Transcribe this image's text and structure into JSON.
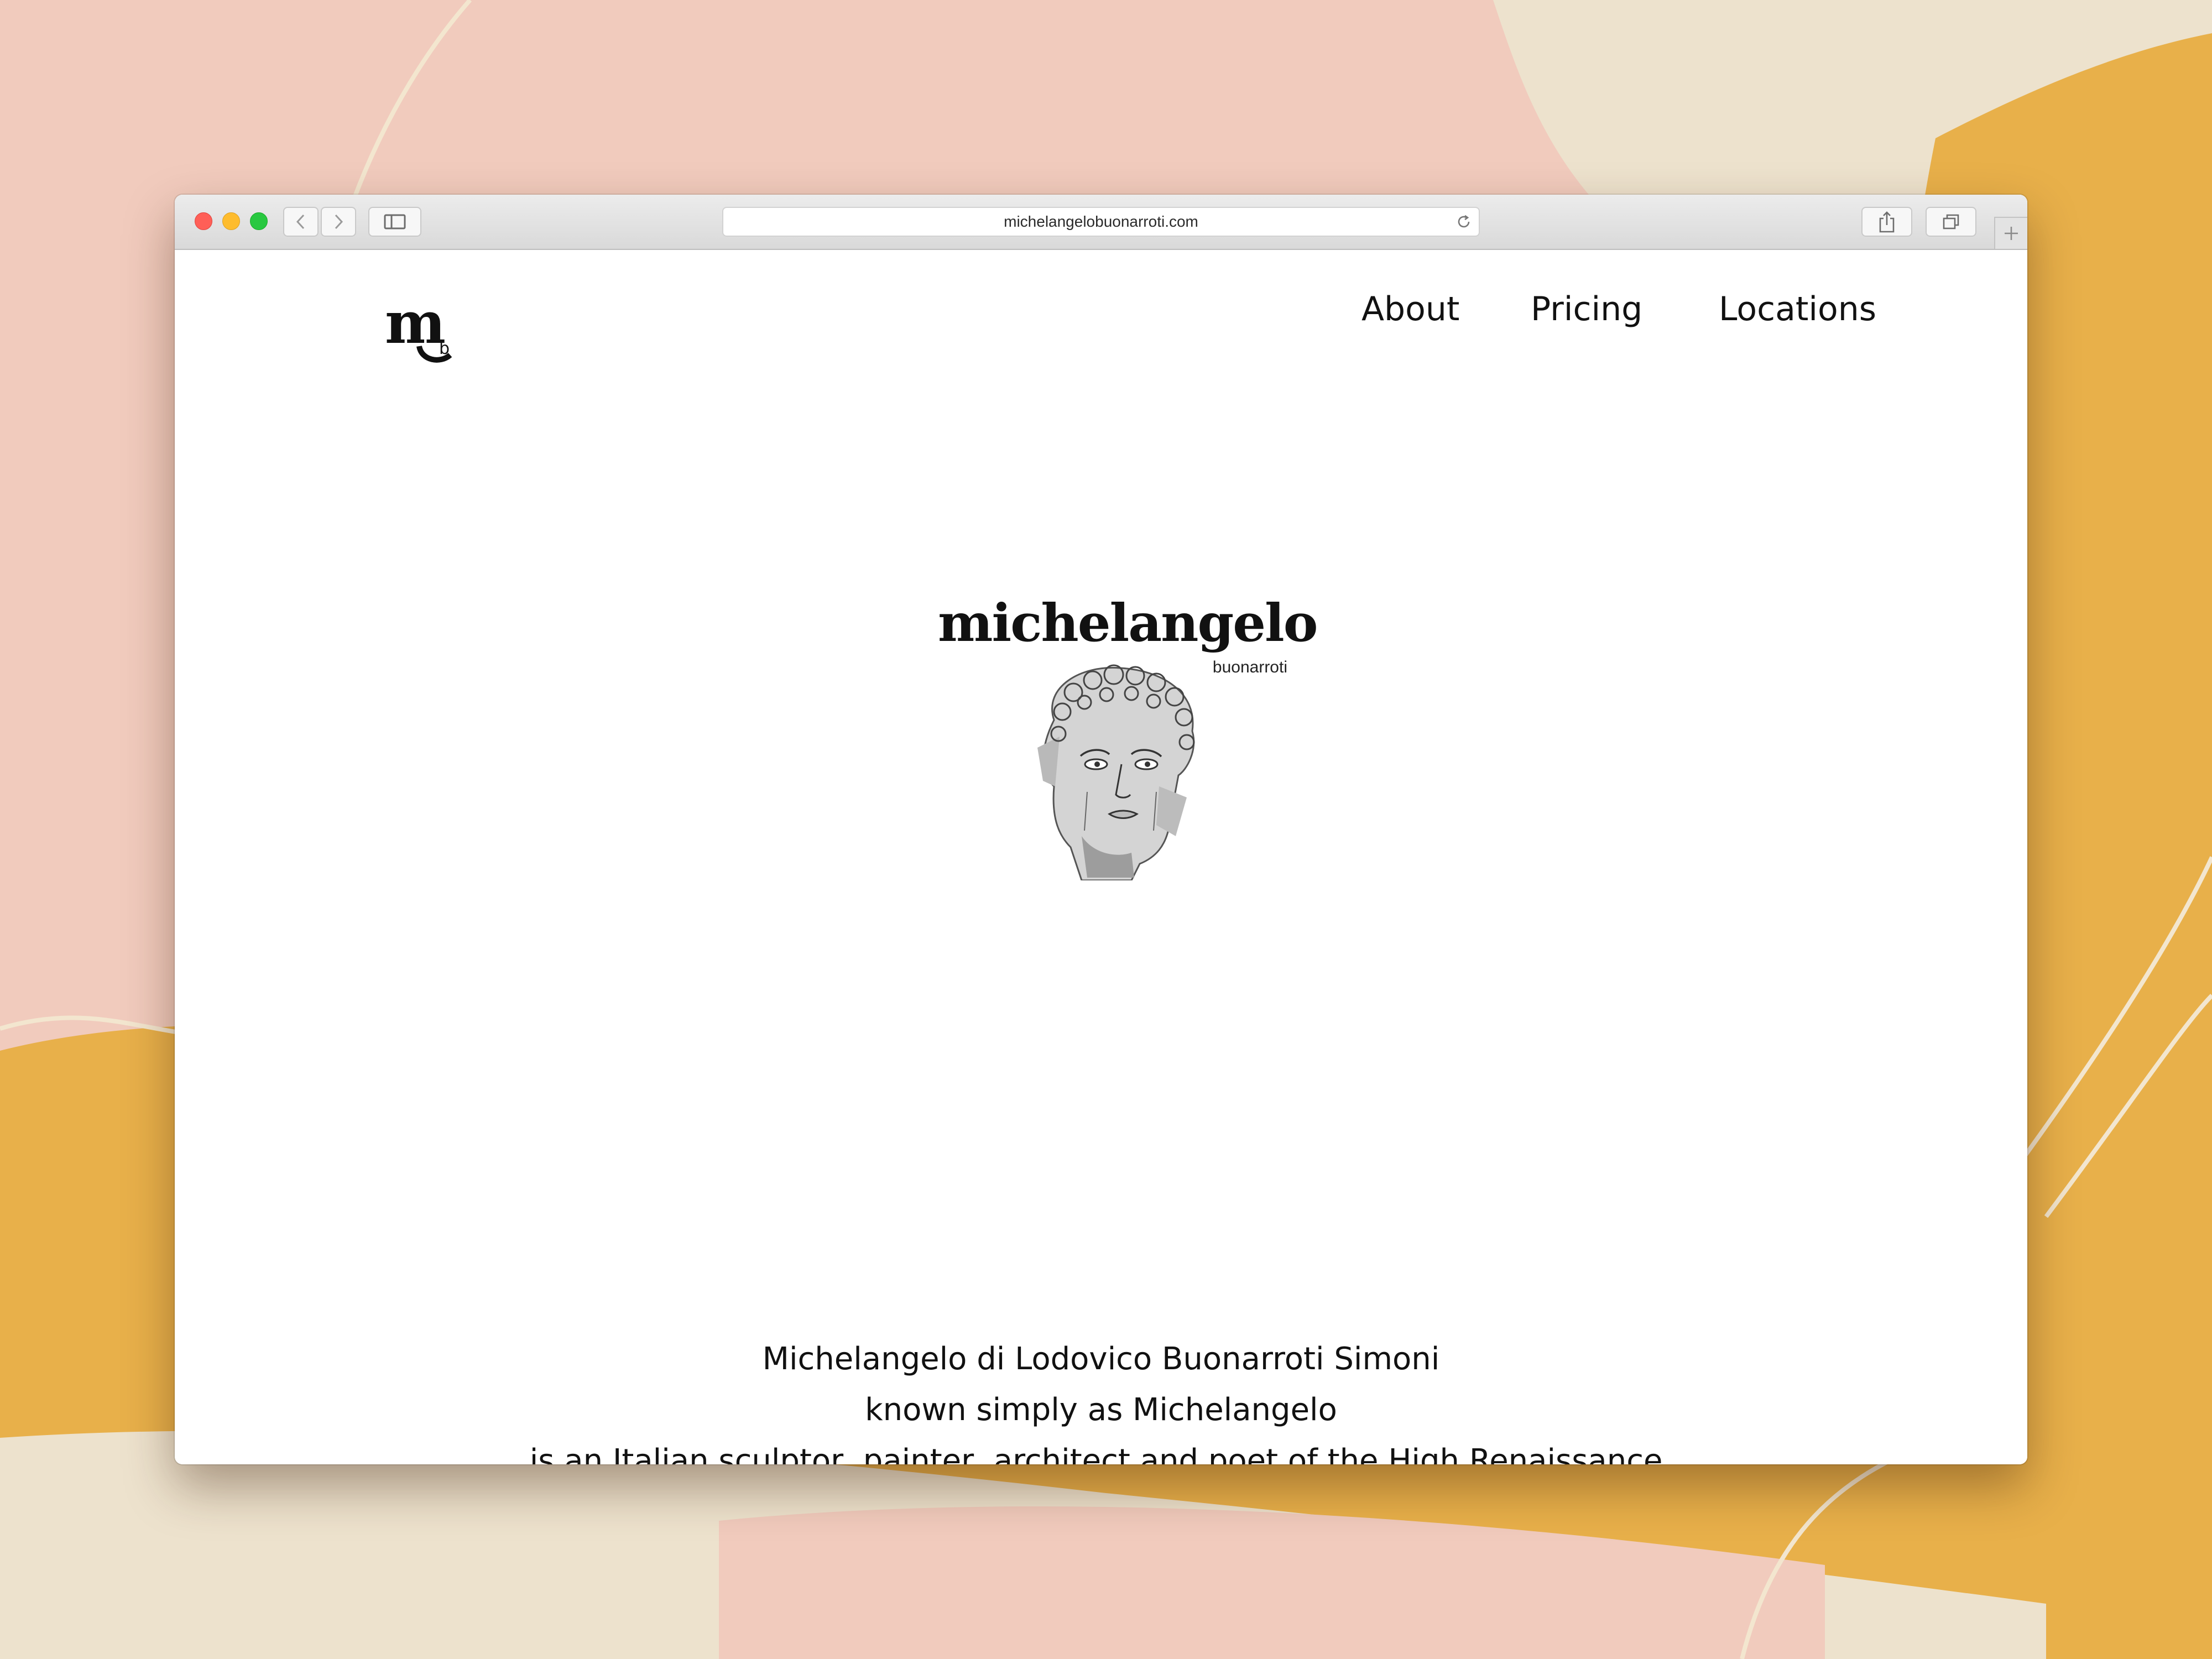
{
  "browser": {
    "url": "michelangelobuonarroti.com",
    "colors": {
      "close": "#ff5f57",
      "minimize": "#febc2e",
      "zoom": "#28c840"
    },
    "icons": [
      "back-icon",
      "forward-icon",
      "sidebar-icon",
      "reload-icon",
      "share-icon",
      "tabs-icon",
      "plus-icon"
    ]
  },
  "site": {
    "logo": {
      "letter": "m",
      "sub": "b"
    },
    "nav": [
      {
        "label": "About"
      },
      {
        "label": "Pricing"
      },
      {
        "label": "Locations"
      }
    ],
    "hero": {
      "title": "michelangelo",
      "subtitle": "buonarroti"
    },
    "bio": [
      "Michelangelo di Lodovico Buonarroti Simoni",
      "known simply as Michelangelo",
      "is an Italian sculptor, painter, architect and poet of the High Renaissance."
    ]
  }
}
